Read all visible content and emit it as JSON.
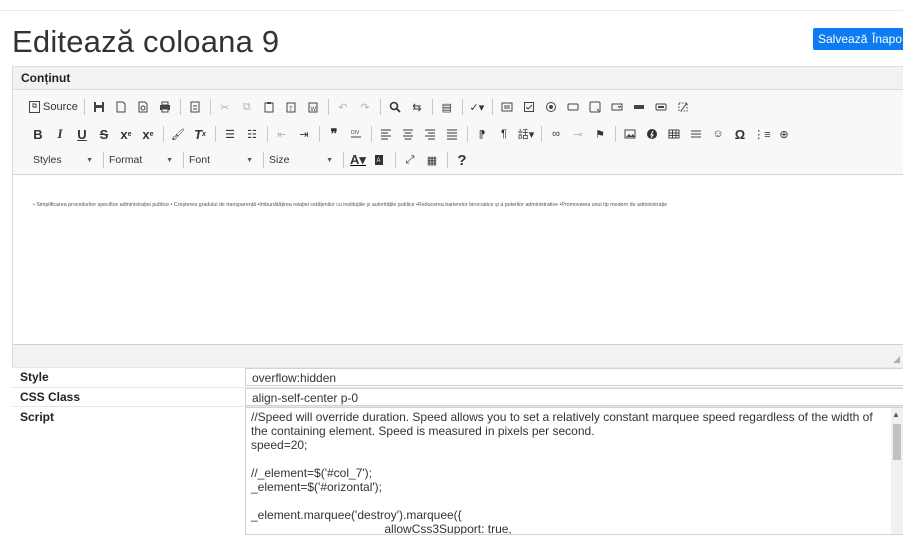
{
  "page": {
    "title": "Editează coloana 9",
    "save_label": "Salvează",
    "back_label": "Înapo"
  },
  "panel": {
    "heading": "Conținut"
  },
  "toolbar": {
    "source_label": "Source",
    "styles_label": "Styles",
    "format_label": "Format",
    "font_label": "Font",
    "size_label": "Size",
    "help_label": "?"
  },
  "editor": {
    "bullet": "•",
    "content": "Simplificarea procedurilor specifice administrației publice • Creșterea gradului de transparență •Îmbunătățirea relației cetățenilor cu instituțiile și autoritățile publice •Reducerea barierelor birocratice și a puterilor administrative •Promovarea unui tip modern de administrație"
  },
  "props": {
    "style_label": "Style",
    "style_value": "overflow:hidden",
    "css_label": "CSS Class",
    "css_value": "align-self-center p-0",
    "script_label": "Script",
    "script_value": "//Speed will override duration. Speed allows you to set a relatively constant marquee speed regardless of the width of the containing element. Speed is measured in pixels per second.\nspeed=20;\n\n//_element=$('#col_7');\n_element=$('#orizontal');\n\n_element.marquee('destroy').marquee({\n                                        allowCss3Support: true,"
  }
}
